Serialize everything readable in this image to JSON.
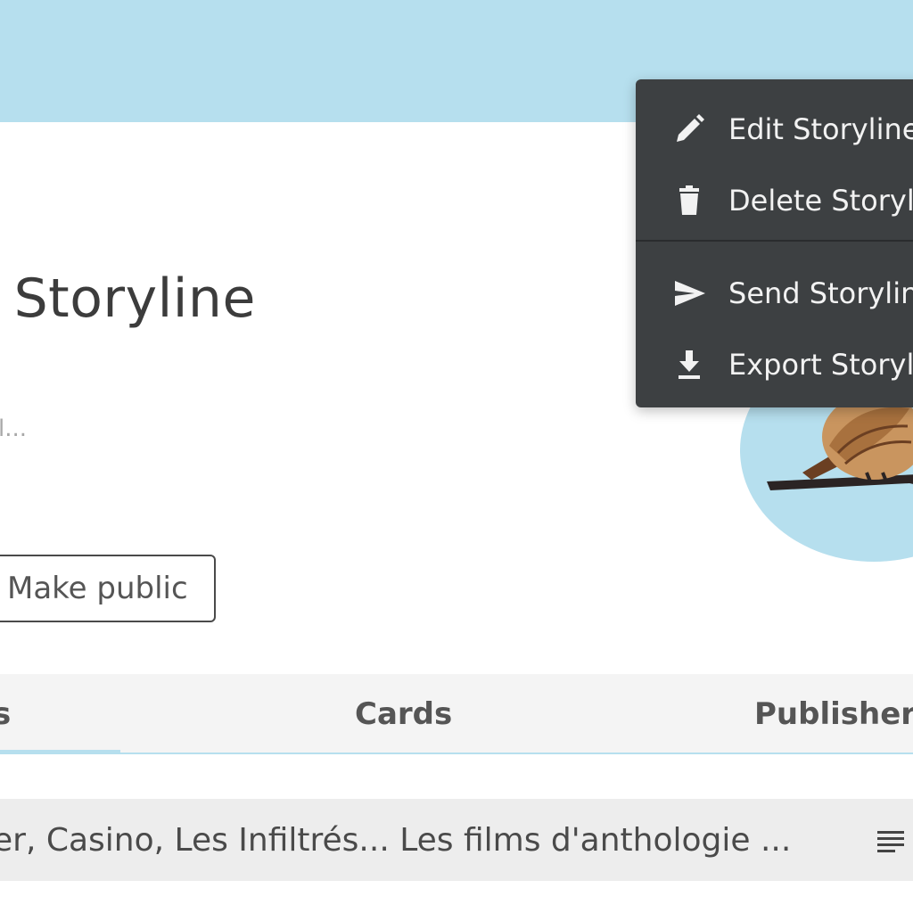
{
  "header": {
    "title": "t Storyline",
    "subtitle": "l..."
  },
  "actions": {
    "make_public_label": "Make public"
  },
  "tabs": [
    {
      "label": "s",
      "active": true
    },
    {
      "label": "Cards",
      "active": false
    },
    {
      "label": "Publisher",
      "active": false
    }
  ],
  "list": {
    "row_text": "er, Casino, Les Infiltrés... Les films d'anthologie ..."
  },
  "menu": {
    "items": [
      {
        "label": "Edit Storyline",
        "icon": "pencil-icon"
      },
      {
        "label": "Delete Storyl",
        "icon": "trash-icon"
      },
      {
        "label": "Send Storylin",
        "icon": "send-icon"
      },
      {
        "label": "Export Storyl",
        "icon": "download-icon"
      }
    ]
  },
  "colors": {
    "banner": "#b6dfee",
    "menu_bg": "#3d4042",
    "text": "#3c3c3c"
  }
}
